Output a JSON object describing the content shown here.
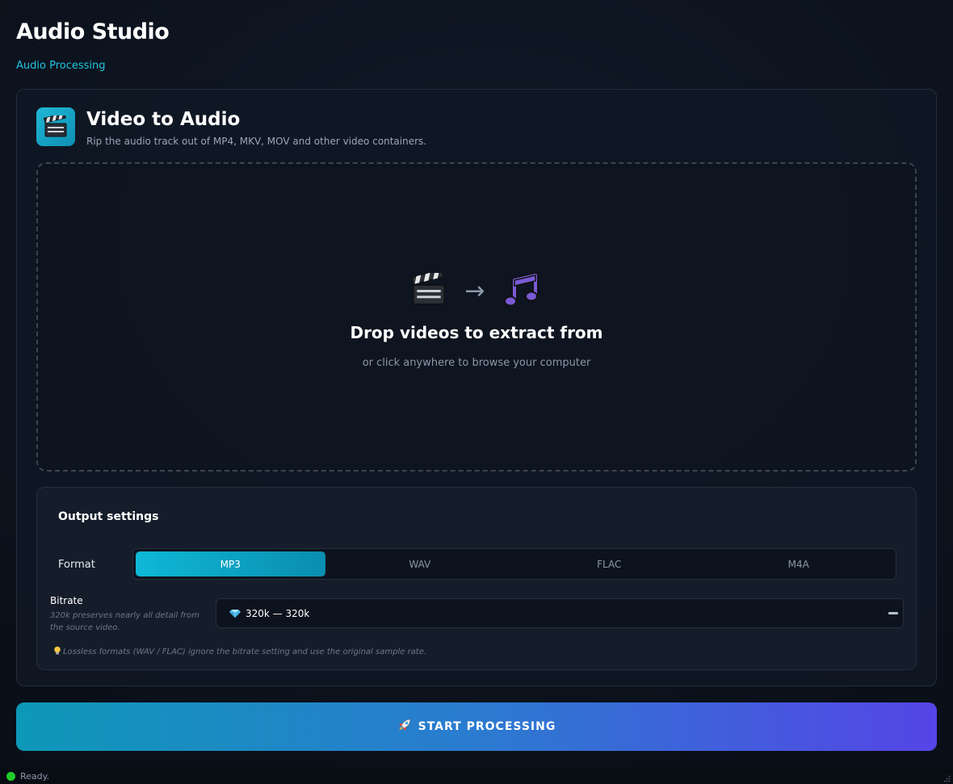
{
  "app": {
    "title": "Audio Studio",
    "subtitle": "Audio Processing"
  },
  "tool": {
    "icon": "clapperboard-icon",
    "title": "Video to Audio",
    "description": "Rip the audio track out of MP4, MKV, MOV and other video containers."
  },
  "dropzone": {
    "source_icon": "clapperboard-icon",
    "arrow": "→",
    "target_icon": "music-note-icon",
    "title": "Drop videos to extract from",
    "hint": "or click anywhere to browse your computer"
  },
  "settings": {
    "title": "Output settings",
    "format_label": "Format",
    "formats": [
      "MP3",
      "WAV",
      "FLAC",
      "M4A"
    ],
    "selected_format": "MP3",
    "bitrate_label": "Bitrate",
    "bitrate_help": "320k preserves nearly all detail from the source video.",
    "bitrate_icon": "gem-icon",
    "bitrate_value": "320k — 320k",
    "note_icon": "lightbulb-icon",
    "note": "Lossless formats (WAV / FLAC) ignore the bitrate setting and use the original sample rate."
  },
  "actions": {
    "start_icon": "rocket-icon",
    "start_label": "START PROCESSING"
  },
  "status": {
    "text": "Ready.",
    "color": "#1fcc2a"
  },
  "colors": {
    "accent": "#22c4e0",
    "button_gradient_start": "#0e98b8",
    "button_gradient_end": "#5545e6"
  }
}
